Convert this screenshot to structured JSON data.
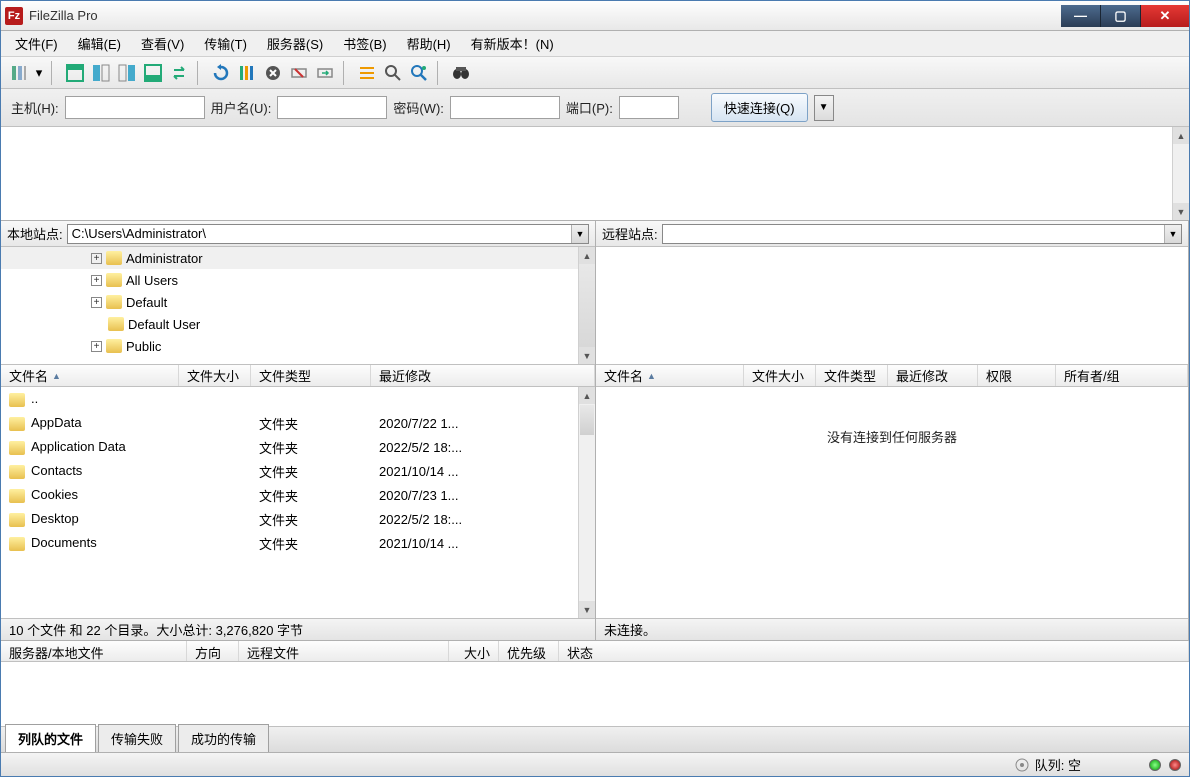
{
  "app": {
    "title": "FileZilla Pro",
    "icon_label": "Fz"
  },
  "menu": [
    "文件(F)",
    "编辑(E)",
    "查看(V)",
    "传输(T)",
    "服务器(S)",
    "书签(B)",
    "帮助(H)",
    "有新版本！(N)"
  ],
  "quick": {
    "host_label": "主机(H):",
    "user_label": "用户名(U):",
    "pass_label": "密码(W):",
    "port_label": "端口(P):",
    "connect_label": "快速连接(Q)",
    "host": "",
    "user": "",
    "pass": "",
    "port": ""
  },
  "local": {
    "label": "本地站点:",
    "path": "C:\\Users\\Administrator\\",
    "tree": [
      {
        "name": "Administrator",
        "expander": "+",
        "selected": true
      },
      {
        "name": "All Users",
        "expander": "+"
      },
      {
        "name": "Default",
        "expander": "+"
      },
      {
        "name": "Default User",
        "expander": ""
      },
      {
        "name": "Public",
        "expander": "+"
      }
    ],
    "columns": [
      "文件名",
      "文件大小",
      "文件类型",
      "最近修改"
    ],
    "files": [
      {
        "name": "..",
        "type": "",
        "date": ""
      },
      {
        "name": "AppData",
        "type": "文件夹",
        "date": "2020/7/22 1..."
      },
      {
        "name": "Application Data",
        "type": "文件夹",
        "date": "2022/5/2 18:..."
      },
      {
        "name": "Contacts",
        "type": "文件夹",
        "date": "2021/10/14 ..."
      },
      {
        "name": "Cookies",
        "type": "文件夹",
        "date": "2020/7/23 1..."
      },
      {
        "name": "Desktop",
        "type": "文件夹",
        "date": "2022/5/2 18:..."
      },
      {
        "name": "Documents",
        "type": "文件夹",
        "date": "2021/10/14 ..."
      }
    ],
    "status": "10 个文件 和 22 个目录。大小总计: 3,276,820 字节"
  },
  "remote": {
    "label": "远程站点:",
    "path": "",
    "columns": [
      "文件名",
      "文件大小",
      "文件类型",
      "最近修改",
      "权限",
      "所有者/组"
    ],
    "empty_msg": "没有连接到任何服务器",
    "status": "未连接。"
  },
  "queue": {
    "columns": [
      "服务器/本地文件",
      "方向",
      "远程文件",
      "大小",
      "优先级",
      "状态"
    ],
    "tabs": [
      "列队的文件",
      "传输失败",
      "成功的传输"
    ],
    "active_tab": 0
  },
  "statusbar": {
    "queue_label": "队列: 空"
  }
}
